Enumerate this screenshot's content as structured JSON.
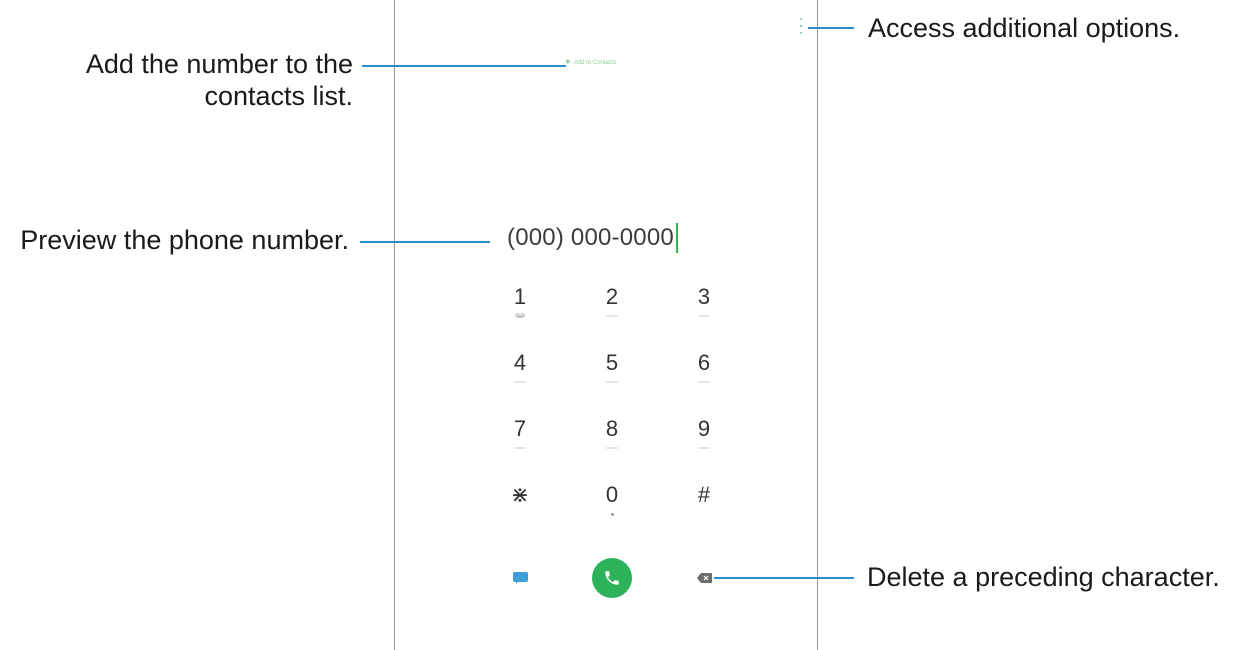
{
  "screen": {
    "add_to_contacts": "Add to Contacts",
    "phone_number": "(000) 000-0000",
    "more_options_icon": "more-vertical-icon",
    "keypad": [
      {
        "digit": "1",
        "sub": "voicemail"
      },
      {
        "digit": "2",
        "sub": "ABC"
      },
      {
        "digit": "3",
        "sub": "DEF"
      },
      {
        "digit": "4",
        "sub": "GHI"
      },
      {
        "digit": "5",
        "sub": "JKL"
      },
      {
        "digit": "6",
        "sub": "MNO"
      },
      {
        "digit": "7",
        "sub": "PQRS"
      },
      {
        "digit": "8",
        "sub": "TUV"
      },
      {
        "digit": "9",
        "sub": "WXYZ"
      },
      {
        "digit": "⋇",
        "sub": ""
      },
      {
        "digit": "0",
        "sub": "+"
      },
      {
        "digit": "#",
        "sub": ""
      }
    ],
    "bottom_icons": {
      "message": "message-icon",
      "call": "phone-icon",
      "delete": "backspace-icon"
    },
    "colors": {
      "accent_green": "#2db45b",
      "message_blue": "#3e9fd8",
      "callout_line": "#2e8bc9"
    }
  },
  "annotations": {
    "add_contact_line1": "Add the number to the",
    "add_contact_line2": "contacts list.",
    "more_options": "Access additional options.",
    "preview": "Preview the phone number.",
    "delete": "Delete a preceding character."
  }
}
